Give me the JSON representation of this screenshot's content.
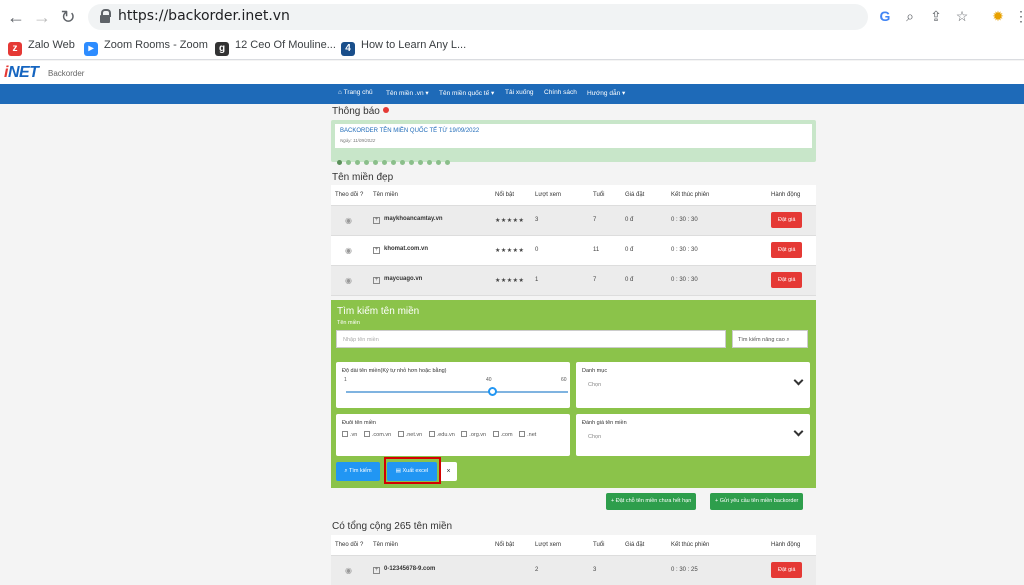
{
  "browser": {
    "url": "https://backorder.inet.vn",
    "bookmarks": [
      "Zalo Web",
      "Zoom Rooms - Zoom",
      "12 Ceo Of Mouline...",
      "How to Learn Any L..."
    ]
  },
  "header": {
    "logo": "iNET",
    "logo_sub": "Backorder",
    "menu": [
      "Trang chủ",
      "Tên miền .vn ▾",
      "Tên miền quốc tế ▾",
      "Tải xuống",
      "Chính sách",
      "Hướng dẫn ▾"
    ]
  },
  "notice": {
    "title": "Thông báo",
    "link": "BACKORDER TÊN MIỀN QUỐC TẾ TỪ 19/09/2022",
    "date": "Ngày: 11/09/2022"
  },
  "featured": {
    "title": "Tên miền đẹp",
    "columns": [
      "Theo dõi ?",
      "Tên miền",
      "Nổi bật",
      "Lượt xem",
      "Tuổi",
      "Giá đặt",
      "Kết thúc phiên",
      "Hành động"
    ],
    "rows": [
      {
        "domain": "maykhoancamtay.vn",
        "stars": "★★★★★",
        "views": "3",
        "age": "7",
        "price": "0 đ",
        "ends": "0 : 30 : 30",
        "action": "Đặt giá"
      },
      {
        "domain": "khomat.com.vn",
        "stars": "★★★★★",
        "views": "0",
        "age": "11",
        "price": "0 đ",
        "ends": "0 : 30 : 30",
        "action": "Đặt giá"
      },
      {
        "domain": "maycuago.vn",
        "stars": "★★★★★",
        "views": "1",
        "age": "7",
        "price": "0 đ",
        "ends": "0 : 30 : 30",
        "action": "Đặt giá"
      }
    ]
  },
  "search": {
    "title": "Tìm kiếm tên miền",
    "domain_label": "Tên miền",
    "placeholder": "Nhập tên miền",
    "advanced": "Tìm kiếm nâng cao",
    "length_label": "Độ dài tên miền(Ký tự nhỏ hơn hoặc bằng)",
    "slider_min": "1",
    "slider_value": "40",
    "slider_max": "60",
    "slider_fraction": 0.66,
    "category_label": "Danh mục",
    "category_value": "Chọn",
    "tld_label": "Đuôi tên miền",
    "tlds": [
      ".vn",
      ".com.vn",
      ".net.vn",
      ".edu.vn",
      ".org.vn",
      ".com",
      ".net"
    ],
    "rating_label": "Đánh giá tên miền",
    "rating_value": "Chọn",
    "search_btn": "Tìm kiếm",
    "excel_btn": "Xuất excel",
    "clear_btn": "×"
  },
  "actions": {
    "expired": "Đặt chỗ tên miền chưa hết hạn",
    "request": "Gửi yêu cầu tên miền backorder"
  },
  "total": {
    "title": "Có tổng cộng 265 tên miền",
    "columns": [
      "Theo dõi ?",
      "Tên miền",
      "Nổi bật",
      "Lượt xem",
      "Tuổi",
      "Giá đặt",
      "Kết thúc phiên",
      "Hành động"
    ],
    "rows": [
      {
        "domain": "0-12345678-9.com",
        "stars": "",
        "views": "2",
        "age": "3",
        "price": "",
        "ends": "0 : 30 : 25",
        "action": "Đặt giá"
      }
    ]
  }
}
